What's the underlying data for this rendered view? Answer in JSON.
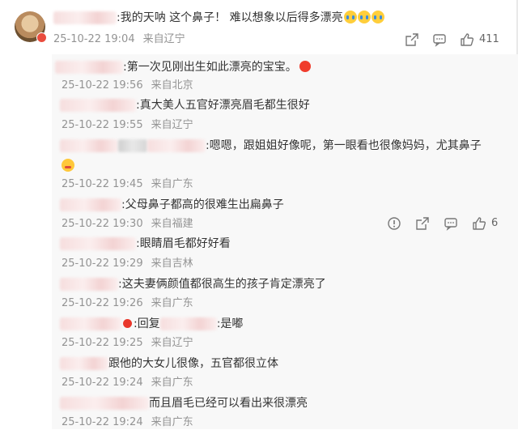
{
  "main_comment": {
    "text": ":我的天呐  这个鼻子！  难以想象以后得多漂亮",
    "date": "25-10-22 19:04",
    "location": "来自辽宁",
    "like_count": "411"
  },
  "replies": [
    {
      "text": ":第一次见刚出生如此漂亮的宝宝。",
      "date": "25-10-22 19:56",
      "location": "来自北京"
    },
    {
      "text": ":真大美人五官好漂亮眉毛都生很好",
      "date": "25-10-22 19:55",
      "location": "来自辽宁"
    },
    {
      "text": ":嗯嗯，跟姐姐好像呢，第一眼看也很像妈妈，尤其鼻子",
      "date": "25-10-22 19:45",
      "location": "来自广东"
    },
    {
      "text": ":父母鼻子都高的很难生出扁鼻子",
      "date": "25-10-22 19:30",
      "location": "来自福建",
      "like_count": "6"
    },
    {
      "text": ":眼睛眉毛都好好看",
      "date": "25-10-22 19:29",
      "location": "来自吉林"
    },
    {
      "text": ":这夫妻俩颜值都很高生的孩子肯定漂亮了",
      "date": "25-10-22 19:26",
      "location": "来自广东"
    },
    {
      "text_prefix": ":回复",
      "text_suffix": ":是嘟",
      "date": "25-10-22 19:25",
      "location": "来自辽宁"
    },
    {
      "text": "跟他的大女儿很像，五官都很立体",
      "date": "25-10-22 19:24",
      "location": "来自广东"
    },
    {
      "text": "而且眉毛已经可以看出来很漂亮",
      "date": "25-10-22 19:24",
      "location": "来自广东"
    }
  ],
  "icons": {
    "share": "share-icon",
    "comment": "comment-icon",
    "like": "thumbs-up-icon",
    "report": "report-icon",
    "cry": "crying-emoji",
    "cheer": "cheer-emoji",
    "hot": "flushed-emoji"
  },
  "colors": {
    "text": "#333333",
    "meta": "#939393",
    "panel_bg": "#f8f8f8",
    "badge_red": "#e9372b"
  }
}
